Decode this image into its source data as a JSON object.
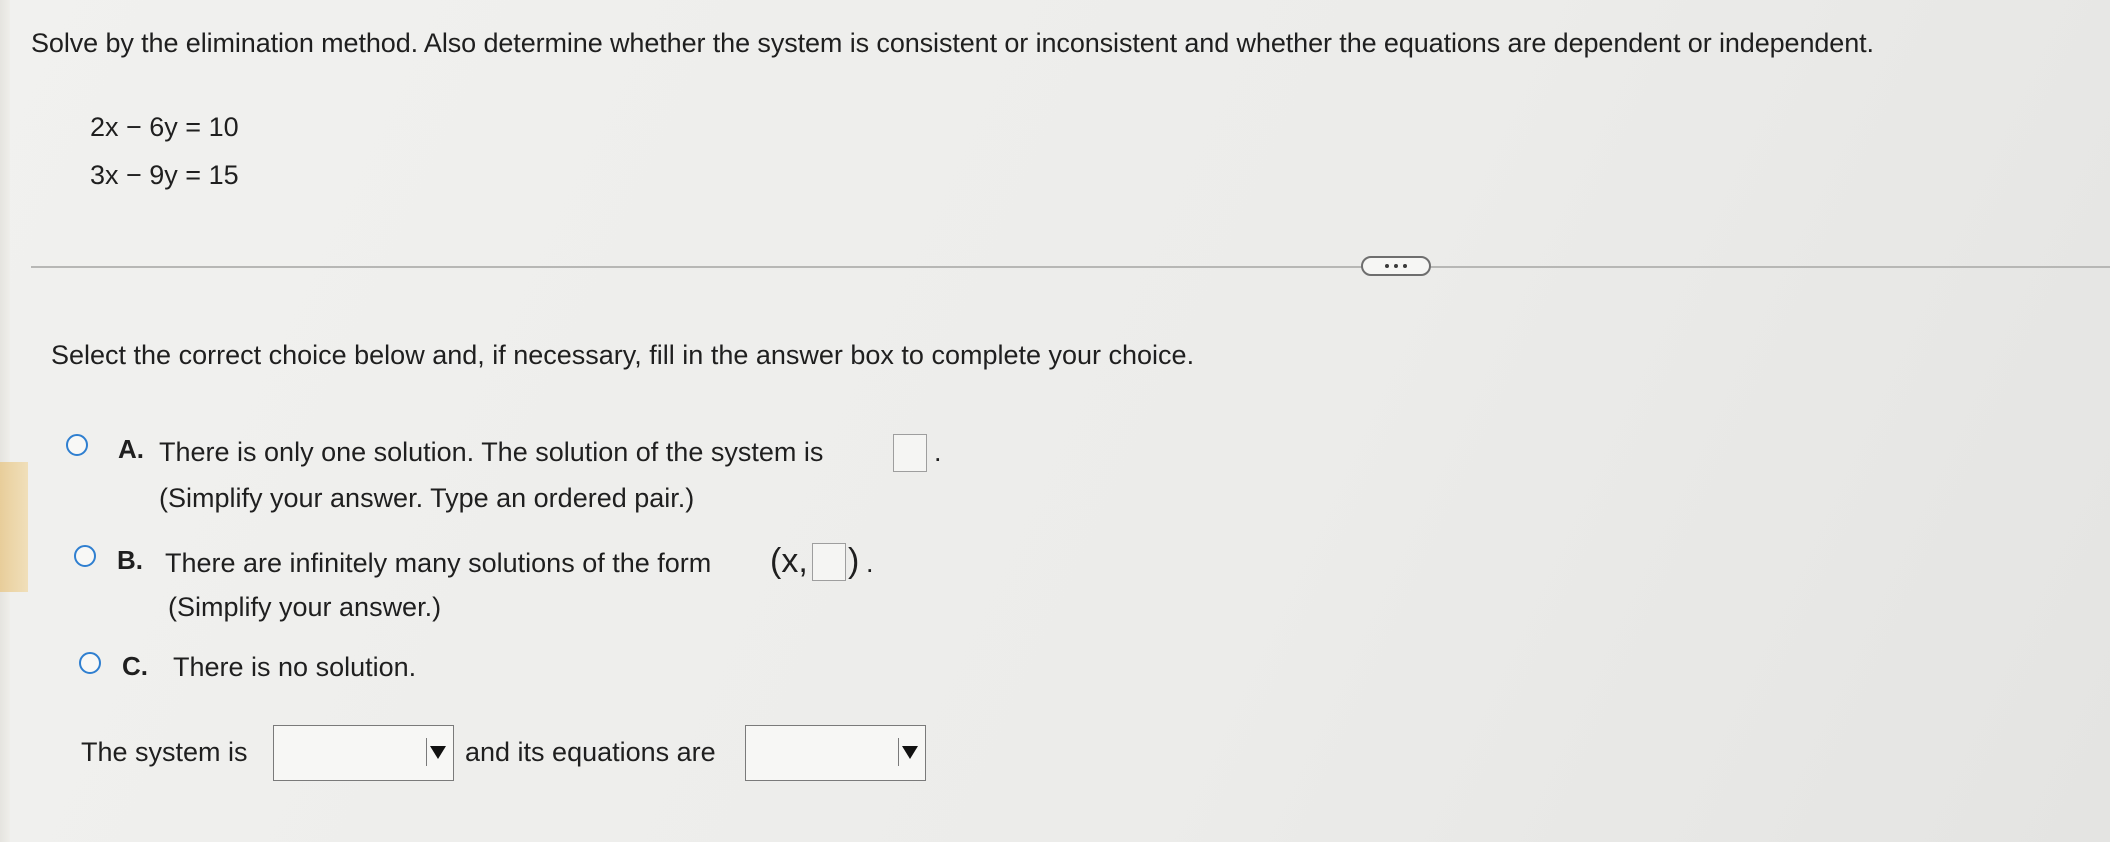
{
  "question": {
    "instructions": "Solve by the elimination method. Also determine whether the system is consistent or inconsistent and whether the equations are dependent or independent.",
    "equations": [
      "2x − 6y  = 10",
      "3x − 9y  = 15"
    ]
  },
  "more_button": {
    "icon": "ellipsis-icon"
  },
  "prompt": "Select the correct choice below and, if necessary, fill in the answer box to complete your choice.",
  "choices": [
    {
      "letter": "A.",
      "text_line1": "There is only one solution. The solution of the system is",
      "text_line2": "(Simplify your answer. Type an ordered pair.)",
      "answer_value": "",
      "trailing": "."
    },
    {
      "letter": "B.",
      "text_line1": "There are infinitely many solutions of the form",
      "form_prefix": "(x,",
      "form_suffix": ")",
      "text_line2": "(Simplify your answer.)",
      "answer_value": "",
      "trailing": "."
    },
    {
      "letter": "C.",
      "text_line1": "There is no solution."
    }
  ],
  "bottom": {
    "system_label": "The system is",
    "system_selected": "",
    "equations_label": "and its equations are",
    "equations_selected": ""
  },
  "colors": {
    "radio_border": "#2f7fd0",
    "accent_strip": "#e8c98e"
  }
}
